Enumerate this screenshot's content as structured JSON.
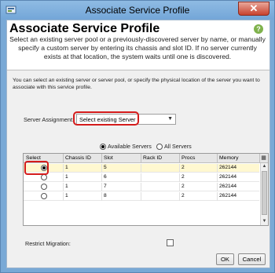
{
  "window": {
    "title": "Associate Service Profile",
    "close_glyph": "✕",
    "app_icon": "ucs-manager-icon"
  },
  "header": {
    "title": "Associate Service Profile",
    "help_glyph": "?",
    "description": "Select an existing server pool or a previously-discovered server by name, or manually specify a custom server by entering its chassis and slot ID. If no server currently exists at that location, the system waits until one is discovered."
  },
  "info_text": "You can select an existing server or server pool, or specify the physical location of the server you want to associate with this service profile.",
  "server_assignment": {
    "label": "Server Assignment:",
    "value": "Select existing Server"
  },
  "filter": {
    "options": [
      {
        "label": "Available Servers",
        "selected": true
      },
      {
        "label": "All Servers",
        "selected": false
      }
    ]
  },
  "table": {
    "columns": [
      "Select",
      "Chassis ID",
      "Slot",
      "Rack ID",
      "Procs",
      "Memory"
    ],
    "rows": [
      {
        "selected": true,
        "chassis": "1",
        "slot": "5",
        "rack": "",
        "procs": "2",
        "memory": "262144"
      },
      {
        "selected": false,
        "chassis": "1",
        "slot": "6",
        "rack": "",
        "procs": "2",
        "memory": "262144"
      },
      {
        "selected": false,
        "chassis": "1",
        "slot": "7",
        "rack": "",
        "procs": "2",
        "memory": "262144"
      },
      {
        "selected": false,
        "chassis": "1",
        "slot": "8",
        "rack": "",
        "procs": "2",
        "memory": "262144"
      }
    ]
  },
  "restrict_migration": {
    "label": "Restrict Migration:",
    "checked": false
  },
  "buttons": {
    "ok": "OK",
    "cancel": "Cancel"
  },
  "colors": {
    "title_bar": "#79a9d6",
    "highlight": "#d41c1c",
    "help": "#7fb24c"
  }
}
